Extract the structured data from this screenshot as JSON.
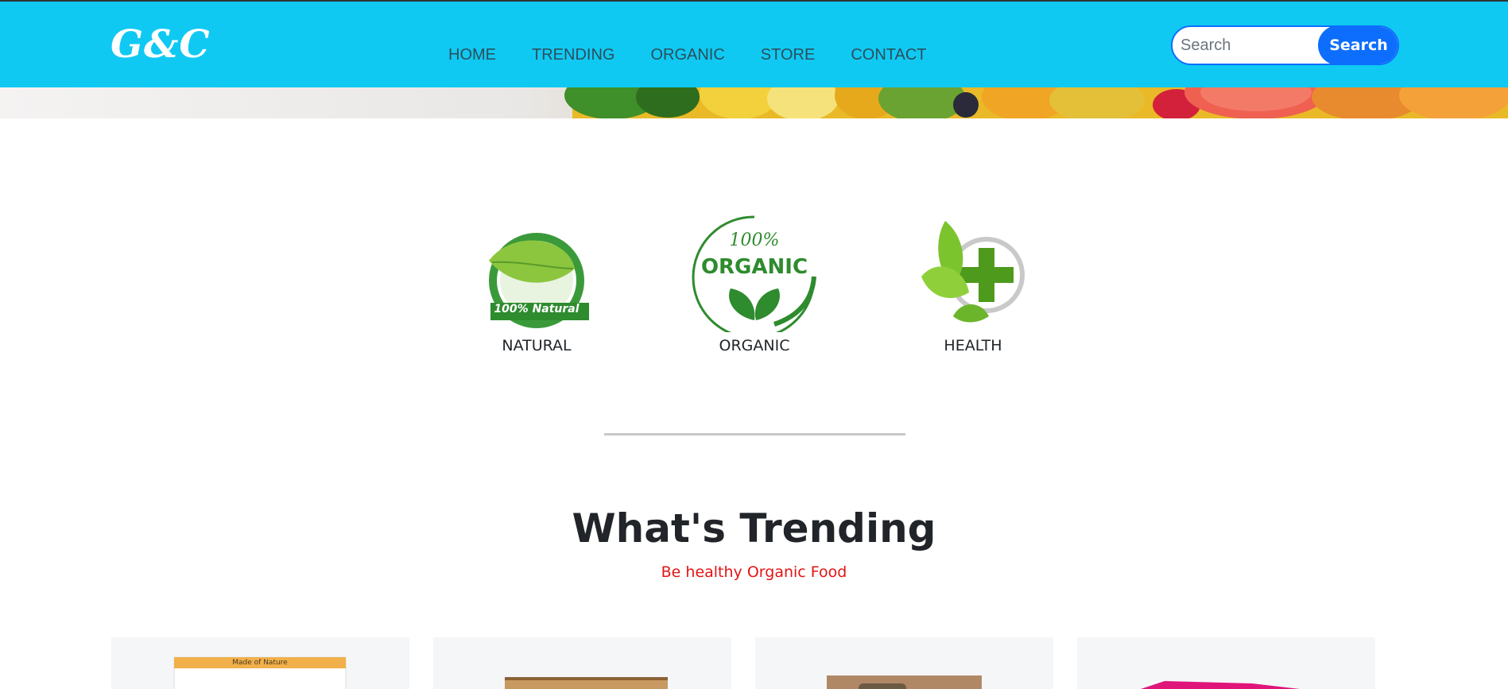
{
  "brand": "G&C",
  "nav": {
    "items": [
      "HOME",
      "TRENDING",
      "ORGANIC",
      "STORE",
      "CONTACT"
    ]
  },
  "search": {
    "placeholder": "Search",
    "button_label": "Search"
  },
  "features": [
    {
      "label": "NATURAL",
      "badge_text": "100% Natural",
      "icon": "natural-leaf-badge-icon"
    },
    {
      "label": "ORGANIC",
      "badge_top": "100%",
      "badge_main": "ORGANIC",
      "icon": "organic-leaf-badge-icon"
    },
    {
      "label": "HEALTH",
      "icon": "health-cross-leaf-icon"
    }
  ],
  "trending": {
    "title": "What's Trending",
    "subtitle": "Be healthy Organic Food"
  },
  "products": [
    {
      "pack_text": "Made of Nature"
    },
    {},
    {},
    {}
  ],
  "colors": {
    "navbar": "#10c9f2",
    "search_button": "#0d6efd",
    "subtitle": "#e31414",
    "leaf_green": "#2e8b2e"
  }
}
